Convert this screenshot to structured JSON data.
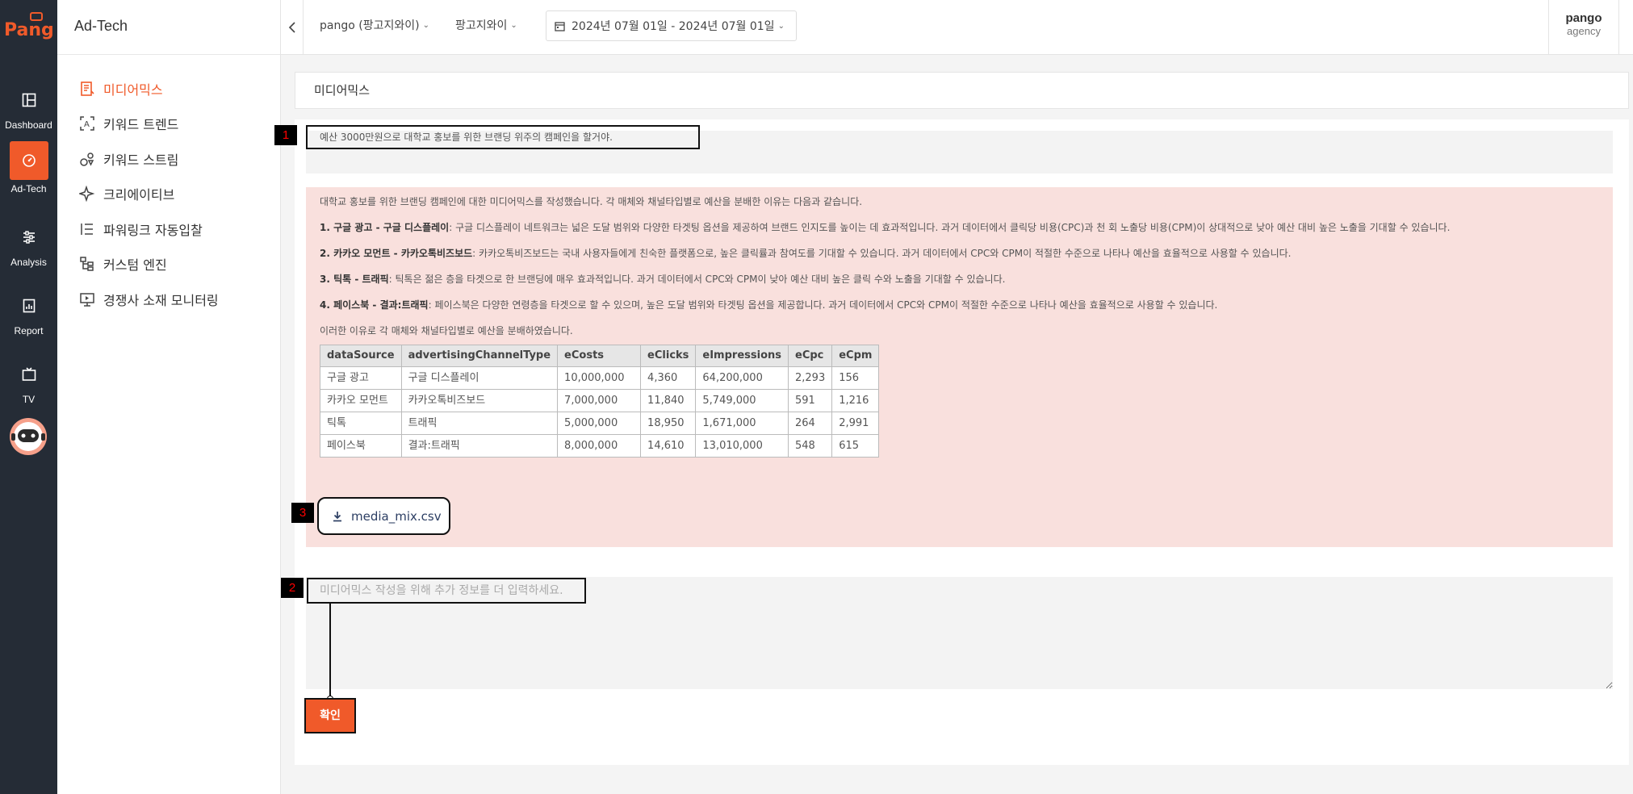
{
  "brand": {
    "logo_text": "Pango",
    "accent": "#f05a2a"
  },
  "rail": [
    {
      "label": "Dashboard",
      "icon": "layout-icon"
    },
    {
      "label": "Ad-Tech",
      "icon": "gauge-icon",
      "active": true
    },
    {
      "label": "Analysis",
      "icon": "sliders-icon"
    },
    {
      "label": "Report",
      "icon": "chart-doc-icon"
    },
    {
      "label": "TV",
      "icon": "tv-icon"
    }
  ],
  "sidebar": {
    "title": "Ad-Tech",
    "items": [
      {
        "label": "미디어믹스",
        "icon": "document-icon",
        "active": true
      },
      {
        "label": "키워드 트렌드",
        "icon": "text-scan-icon"
      },
      {
        "label": "키워드 스트림",
        "icon": "shapes-icon"
      },
      {
        "label": "크리에이티브",
        "icon": "sparkle-icon"
      },
      {
        "label": "파워링크 자동입찰",
        "icon": "list-icon"
      },
      {
        "label": "커스텀 엔진",
        "icon": "hierarchy-icon"
      },
      {
        "label": "경쟁사 소재 모니터링",
        "icon": "monitor-icon"
      }
    ]
  },
  "header": {
    "account": "pango (팡고지와이)",
    "sub_account": "팡고지와이",
    "date_range": "2024년 07월 01일 - 2024년 07월 01일",
    "user_name": "pango",
    "user_role": "agency"
  },
  "main": {
    "page_title": "미디어믹스",
    "prompt": "예산 3000만원으로 대학교 홍보를 위한 브랜딩 위주의 캠페인을 할거야.",
    "response": {
      "intro": "대학교 홍보를 위한 브랜딩 캠페인에 대한 미디어믹스를 작성했습니다. 각 매체와 채널타입별로 예산을 분배한 이유는 다음과 같습니다.",
      "reasons": [
        {
          "title": "1. 구글 광고 - 구글 디스플레이",
          "text": ": 구글 디스플레이 네트워크는 넓은 도달 범위와 다양한 타겟팅 옵션을 제공하여 브랜드 인지도를 높이는 데 효과적입니다. 과거 데이터에서 클릭당 비용(CPC)과 천 회 노출당 비용(CPM)이 상대적으로 낮아 예산 대비 높은 노출을 기대할 수 있습니다."
        },
        {
          "title": "2. 카카오 모먼트 - 카카오톡비즈보드",
          "text": ": 카카오톡비즈보드는 국내 사용자들에게 친숙한 플랫폼으로, 높은 클릭률과 참여도를 기대할 수 있습니다. 과거 데이터에서 CPC와 CPM이 적절한 수준으로 나타나 예산을 효율적으로 사용할 수 있습니다."
        },
        {
          "title": "3. 틱톡 - 트래픽",
          "text": ": 틱톡은 젊은 층을 타겟으로 한 브랜딩에 매우 효과적입니다. 과거 데이터에서 CPC와 CPM이 낮아 예산 대비 높은 클릭 수와 노출을 기대할 수 있습니다."
        },
        {
          "title": "4. 페이스북 - 결과:트래픽",
          "text": ": 페이스북은 다양한 연령층을 타겟으로 할 수 있으며, 높은 도달 범위와 타겟팅 옵션을 제공합니다. 과거 데이터에서 CPC와 CPM이 적절한 수준으로 나타나 예산을 효율적으로 사용할 수 있습니다."
        }
      ],
      "closing": "이러한 이유로 각 매체와 채널타입별로 예산을 분배하였습니다.",
      "table": {
        "columns": [
          "dataSource",
          "advertisingChannelType",
          "eCosts",
          "eClicks",
          "eImpressions",
          "eCpc",
          "eCpm"
        ],
        "rows": [
          [
            "구글 광고",
            "구글 디스플레이",
            "10,000,000",
            "4,360",
            "64,200,000",
            "2,293",
            "156"
          ],
          [
            "카카오 모먼트",
            "카카오톡비즈보드",
            "7,000,000",
            "11,840",
            "5,749,000",
            "591",
            "1,216"
          ],
          [
            "틱톡",
            "트래픽",
            "5,000,000",
            "18,950",
            "1,671,000",
            "264",
            "2,991"
          ],
          [
            "페이스북",
            "결과:트래픽",
            "8,000,000",
            "14,610",
            "13,010,000",
            "548",
            "615"
          ]
        ]
      },
      "download_label": "media_mix.csv"
    },
    "input_placeholder": "미디어믹스 작성을 위해 추가 정보를 더 입력하세요.",
    "submit_label": "확인"
  },
  "markers": [
    "1",
    "2",
    "3"
  ]
}
